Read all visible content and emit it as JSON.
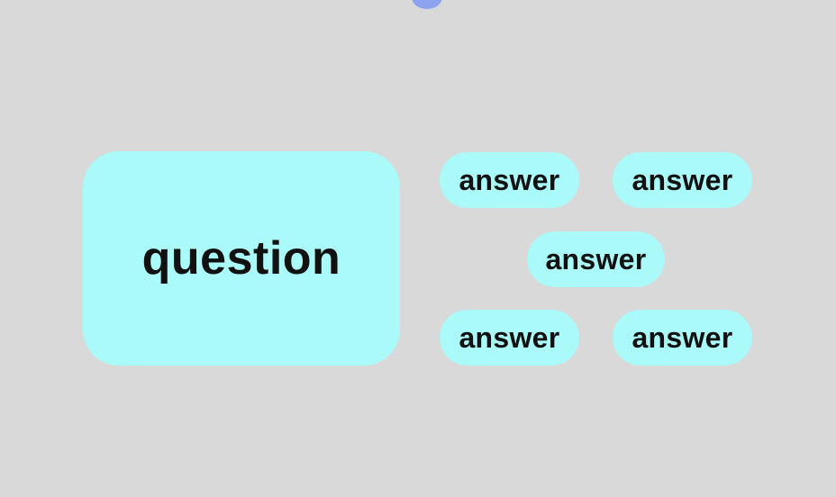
{
  "colors": {
    "background": "#d9d9d9",
    "card": "#aafafa",
    "text": "#111111",
    "accent_dot": "#8ea3f0"
  },
  "question": {
    "label": "question"
  },
  "answers": [
    {
      "label": "answer"
    },
    {
      "label": "answer"
    },
    {
      "label": "answer"
    },
    {
      "label": "answer"
    },
    {
      "label": "answer"
    }
  ]
}
